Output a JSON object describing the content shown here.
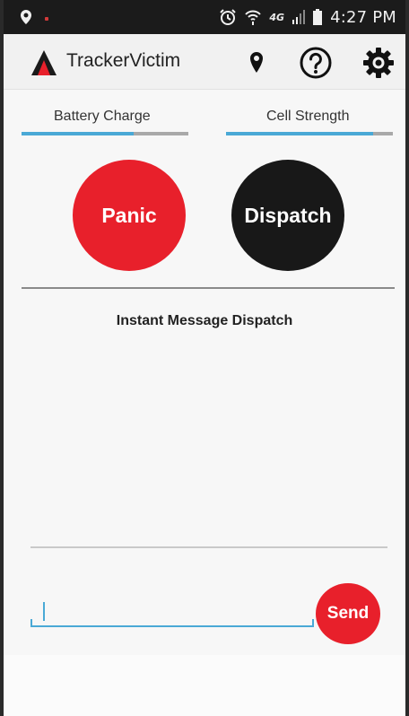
{
  "status_bar": {
    "time": "4:27 PM",
    "network": "4G",
    "icons": [
      "location-icon",
      "alarm-icon",
      "wifi-icon",
      "signal-icon",
      "battery-icon"
    ]
  },
  "app_bar": {
    "title": "TrackerVictim",
    "icons": [
      "logo-icon",
      "location-pin-icon",
      "help-icon",
      "settings-gear-icon"
    ]
  },
  "gauges": {
    "battery": {
      "label": "Battery Charge",
      "level": 0.67
    },
    "cell": {
      "label": "Cell Strength",
      "level": 0.88
    }
  },
  "actions": {
    "panic_label": "Panic",
    "dispatch_label": "Dispatch"
  },
  "message": {
    "section_title": "Instant Message Dispatch",
    "input_value": "",
    "send_label": "Send"
  },
  "colors": {
    "accent": "#4aa9d6",
    "panic": "#e8202b",
    "dispatch": "#181818",
    "status_bar": "#1b1b1b"
  }
}
